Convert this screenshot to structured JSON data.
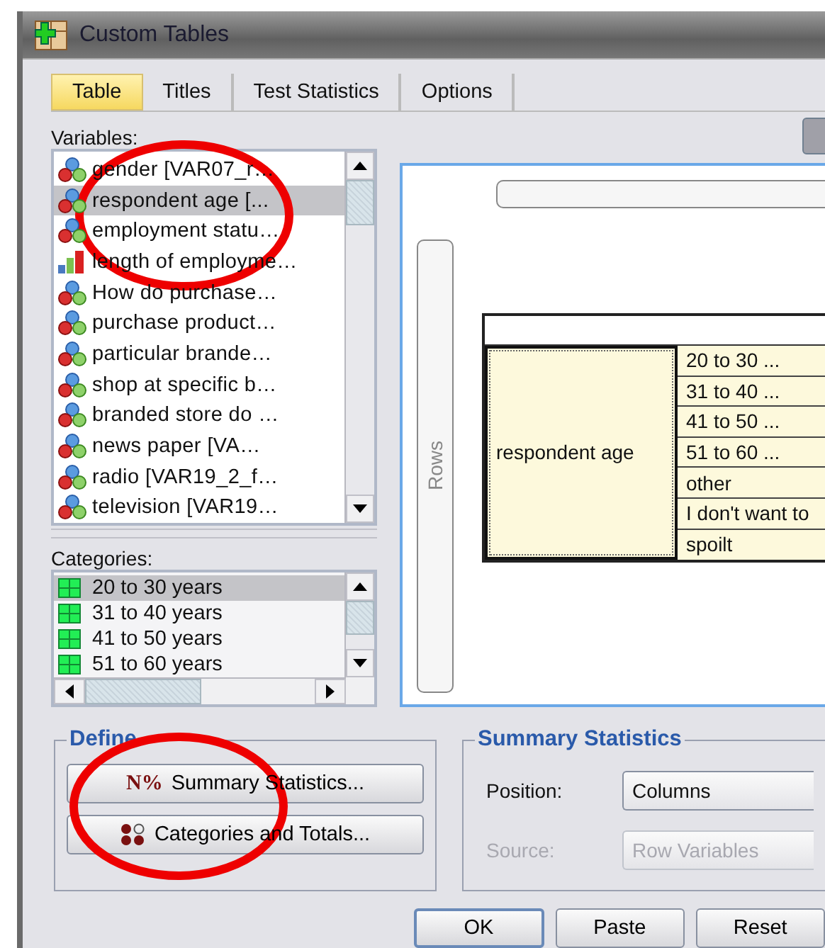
{
  "window": {
    "title": "Custom Tables"
  },
  "tabs": [
    {
      "label": "Table",
      "selected": true
    },
    {
      "label": "Titles",
      "selected": false
    },
    {
      "label": "Test Statistics",
      "selected": false
    },
    {
      "label": "Options",
      "selected": false
    }
  ],
  "variables": {
    "label": "Variables:",
    "items": [
      {
        "name": "gender [VAR07_r…",
        "kind": "nominal",
        "selected": false
      },
      {
        "name": "respondent age [...",
        "kind": "nominal",
        "selected": true
      },
      {
        "name": "employment statu…",
        "kind": "nominal",
        "selected": false
      },
      {
        "name": "length of employme…",
        "kind": "scale",
        "selected": false
      },
      {
        "name": "How do purchase…",
        "kind": "nominal",
        "selected": false
      },
      {
        "name": "purchase product…",
        "kind": "nominal",
        "selected": false
      },
      {
        "name": "particular brande…",
        "kind": "nominal",
        "selected": false
      },
      {
        "name": "shop at specific b…",
        "kind": "nominal",
        "selected": false
      },
      {
        "name": "branded store do …",
        "kind": "nominal",
        "selected": false
      },
      {
        "name": "news paper [VA…",
        "kind": "nominal",
        "selected": false
      },
      {
        "name": "radio [VAR19_2_f…",
        "kind": "nominal",
        "selected": false
      },
      {
        "name": "television [VAR19…",
        "kind": "nominal",
        "selected": false
      }
    ]
  },
  "categories": {
    "label": "Categories:",
    "items": [
      {
        "name": "20 to 30 years",
        "selected": true
      },
      {
        "name": "31 to 40 years",
        "selected": false
      },
      {
        "name": "41 to 50 years",
        "selected": false
      },
      {
        "name": "51 to 60 years",
        "selected": false
      }
    ]
  },
  "canvas": {
    "rows_label": "Rows",
    "row_variable": "respondent age",
    "row_categories": [
      "20 to 30 ...",
      "31 to 40 ...",
      "41 to 50 ...",
      "51 to 60 ...",
      "other",
      "I don't want to",
      "spoilt"
    ]
  },
  "define": {
    "title": "Define",
    "buttons": [
      {
        "label": "Summary Statistics...",
        "kind": "summary",
        "icon": "N%"
      },
      {
        "label": "Categories and Totals...",
        "kind": "categories"
      }
    ]
  },
  "summary_statistics": {
    "title": "Summary Statistics",
    "fields": [
      {
        "label": "Position:",
        "value": "Columns",
        "disabled": false
      },
      {
        "label": "Source:",
        "value": "Row Variables",
        "disabled": true
      }
    ]
  },
  "buttons": [
    {
      "label": "OK",
      "default": true
    },
    {
      "label": "Paste",
      "default": false
    },
    {
      "label": "Reset",
      "default": false
    }
  ]
}
